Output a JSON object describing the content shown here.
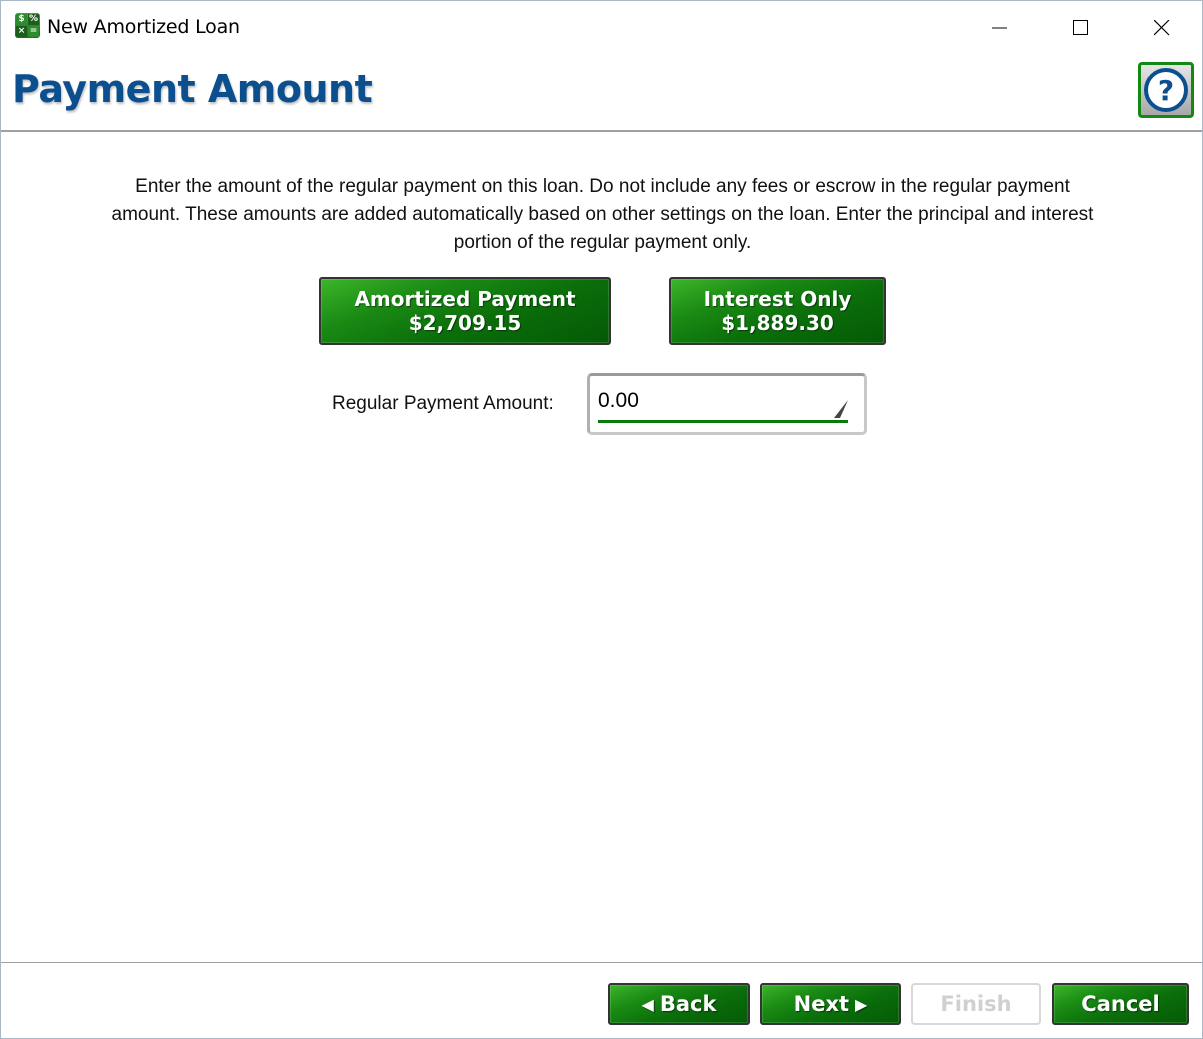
{
  "window": {
    "title": "New Amortized Loan",
    "app_icon_glyphs": [
      "$",
      "%",
      "×",
      "="
    ],
    "controls": {
      "minimize": "minimize-icon",
      "maximize": "maximize-icon",
      "close": "close-icon"
    }
  },
  "header": {
    "title": "Payment Amount",
    "help_label": "?"
  },
  "instructions": "Enter the amount of the regular payment on this loan.  Do not include any fees or escrow in the regular payment amount.  These amounts are added automatically based on other settings on the loan.  Enter the principal and interest portion of the regular payment only.",
  "quick_buttons": [
    {
      "label": "Amortized Payment",
      "amount": "$2,709.15"
    },
    {
      "label": "Interest Only",
      "amount": "$1,889.30"
    }
  ],
  "payment_field": {
    "label": "Regular Payment Amount:",
    "value": "0.00"
  },
  "footer": {
    "back_label": "Back",
    "back_arrow": "◀",
    "next_label": "Next",
    "next_arrow": "▶",
    "finish_label": "Finish",
    "cancel_label": "Cancel"
  },
  "colors": {
    "title_blue": "#0b4f8e",
    "button_green": "#0a6e0a",
    "underline_green": "#0a7a0a",
    "disabled_gray": "#d0d0d0"
  }
}
